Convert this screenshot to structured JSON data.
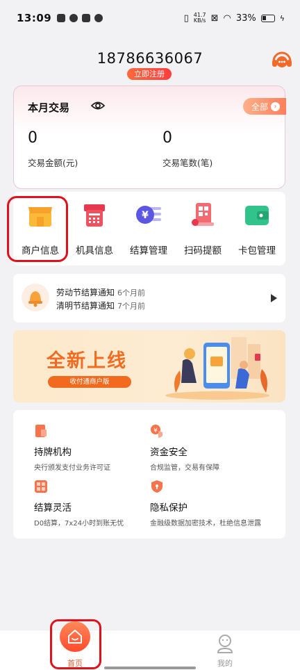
{
  "status_bar": {
    "time": "13:09",
    "speed_value": "41.7",
    "speed_unit": "KB/s",
    "battery": "33%"
  },
  "header": {
    "phone": "18786636067",
    "register": "立即注册"
  },
  "card": {
    "title": "本月交易",
    "all": "全部",
    "amount_value": "0",
    "amount_label": "交易金额(元)",
    "count_value": "0",
    "count_label": "交易笔数(笔)"
  },
  "menu": [
    {
      "label": "商户信息",
      "icon": "store-icon"
    },
    {
      "label": "机具信息",
      "icon": "pos-terminal-icon"
    },
    {
      "label": "结算管理",
      "icon": "yuan-settlement-icon"
    },
    {
      "label": "扫码提额",
      "icon": "qr-code-icon"
    },
    {
      "label": "卡包管理",
      "icon": "wallet-icon"
    }
  ],
  "notices": [
    {
      "title": "劳动节结算通知",
      "ago": "6个月前"
    },
    {
      "title": "清明节结算通知",
      "ago": "7个月前"
    }
  ],
  "banner": {
    "title": "全新上线",
    "pill": "收付通商户版"
  },
  "features": [
    {
      "title": "持牌机构",
      "desc": "央行颁发支付业务许可证",
      "color": "#f6734b"
    },
    {
      "title": "资金安全",
      "desc": "合规监管，交易有保障",
      "color": "#f47a52"
    },
    {
      "title": "结算灵活",
      "desc": "D0结算，7x24小时到账无忧",
      "color": "#f6734b"
    },
    {
      "title": "隐私保护",
      "desc": "金融级数据加密技术，杜绝信息泄露",
      "color": "#f47a52"
    }
  ],
  "tabbar": {
    "home": "首页",
    "mine": "我的"
  },
  "colors": {
    "accent": "#ff5a2e",
    "highlight": "#e0101c"
  }
}
